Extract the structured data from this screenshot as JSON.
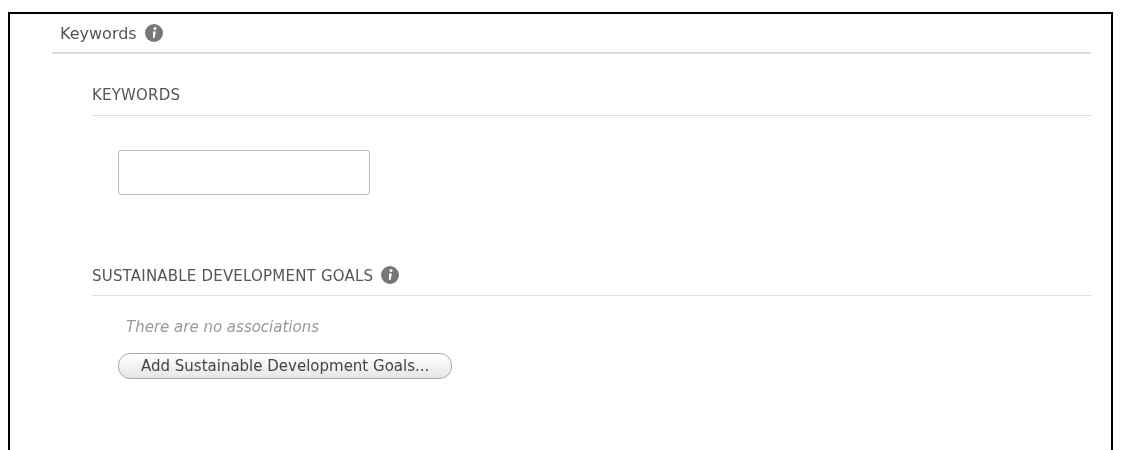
{
  "section": {
    "title": "Keywords",
    "info_icon": true
  },
  "groups": [
    {
      "kind": "input",
      "title": "KEYWORDS",
      "info_icon": false
    },
    {
      "kind": "associations",
      "title": "SUSTAINABLE DEVELOPMENT GOALS",
      "info_icon": true,
      "empty_text": "There are no associations",
      "button": "Add Sustainable Development Goals..."
    }
  ]
}
